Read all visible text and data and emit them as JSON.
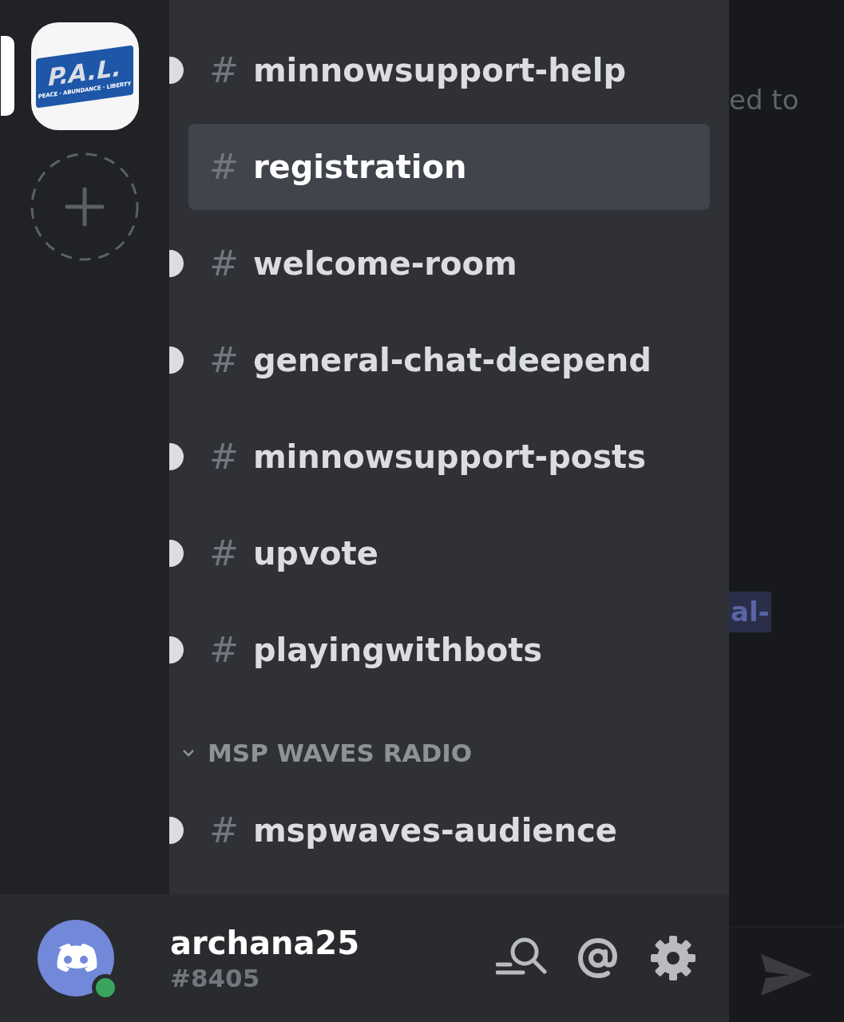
{
  "servers": [
    {
      "selected": true,
      "logo_title": "P.A.L.",
      "logo_tagline": "PEACE · ABUNDANCE · LIBERTY"
    }
  ],
  "sections": [
    {
      "channels": [
        {
          "hash": "#",
          "name": "minnowsupport-help",
          "unread": true,
          "selected": false
        },
        {
          "hash": "#",
          "name": "registration",
          "unread": false,
          "selected": true
        },
        {
          "hash": "#",
          "name": "welcome-room",
          "unread": true,
          "selected": false
        },
        {
          "hash": "#",
          "name": "general-chat-deepend",
          "unread": true,
          "selected": false
        },
        {
          "hash": "#",
          "name": "minnowsupport-posts",
          "unread": true,
          "selected": false
        },
        {
          "hash": "#",
          "name": "upvote",
          "unread": true,
          "selected": false
        },
        {
          "hash": "#",
          "name": "playingwithbots",
          "unread": true,
          "selected": false
        }
      ]
    },
    {
      "category": "MSP WAVES RADIO",
      "expanded": true,
      "channels": [
        {
          "hash": "#",
          "name": "mspwaves-audience",
          "unread": true,
          "selected": false
        }
      ]
    }
  ],
  "chat": {
    "fragments": [
      {
        "kind": "text",
        "text": "ed to"
      },
      {
        "kind": "mention",
        "text": "al-"
      }
    ]
  },
  "user": {
    "name": "archana25",
    "tag": "#8405",
    "status": {
      "color": "#3ba55d"
    }
  }
}
